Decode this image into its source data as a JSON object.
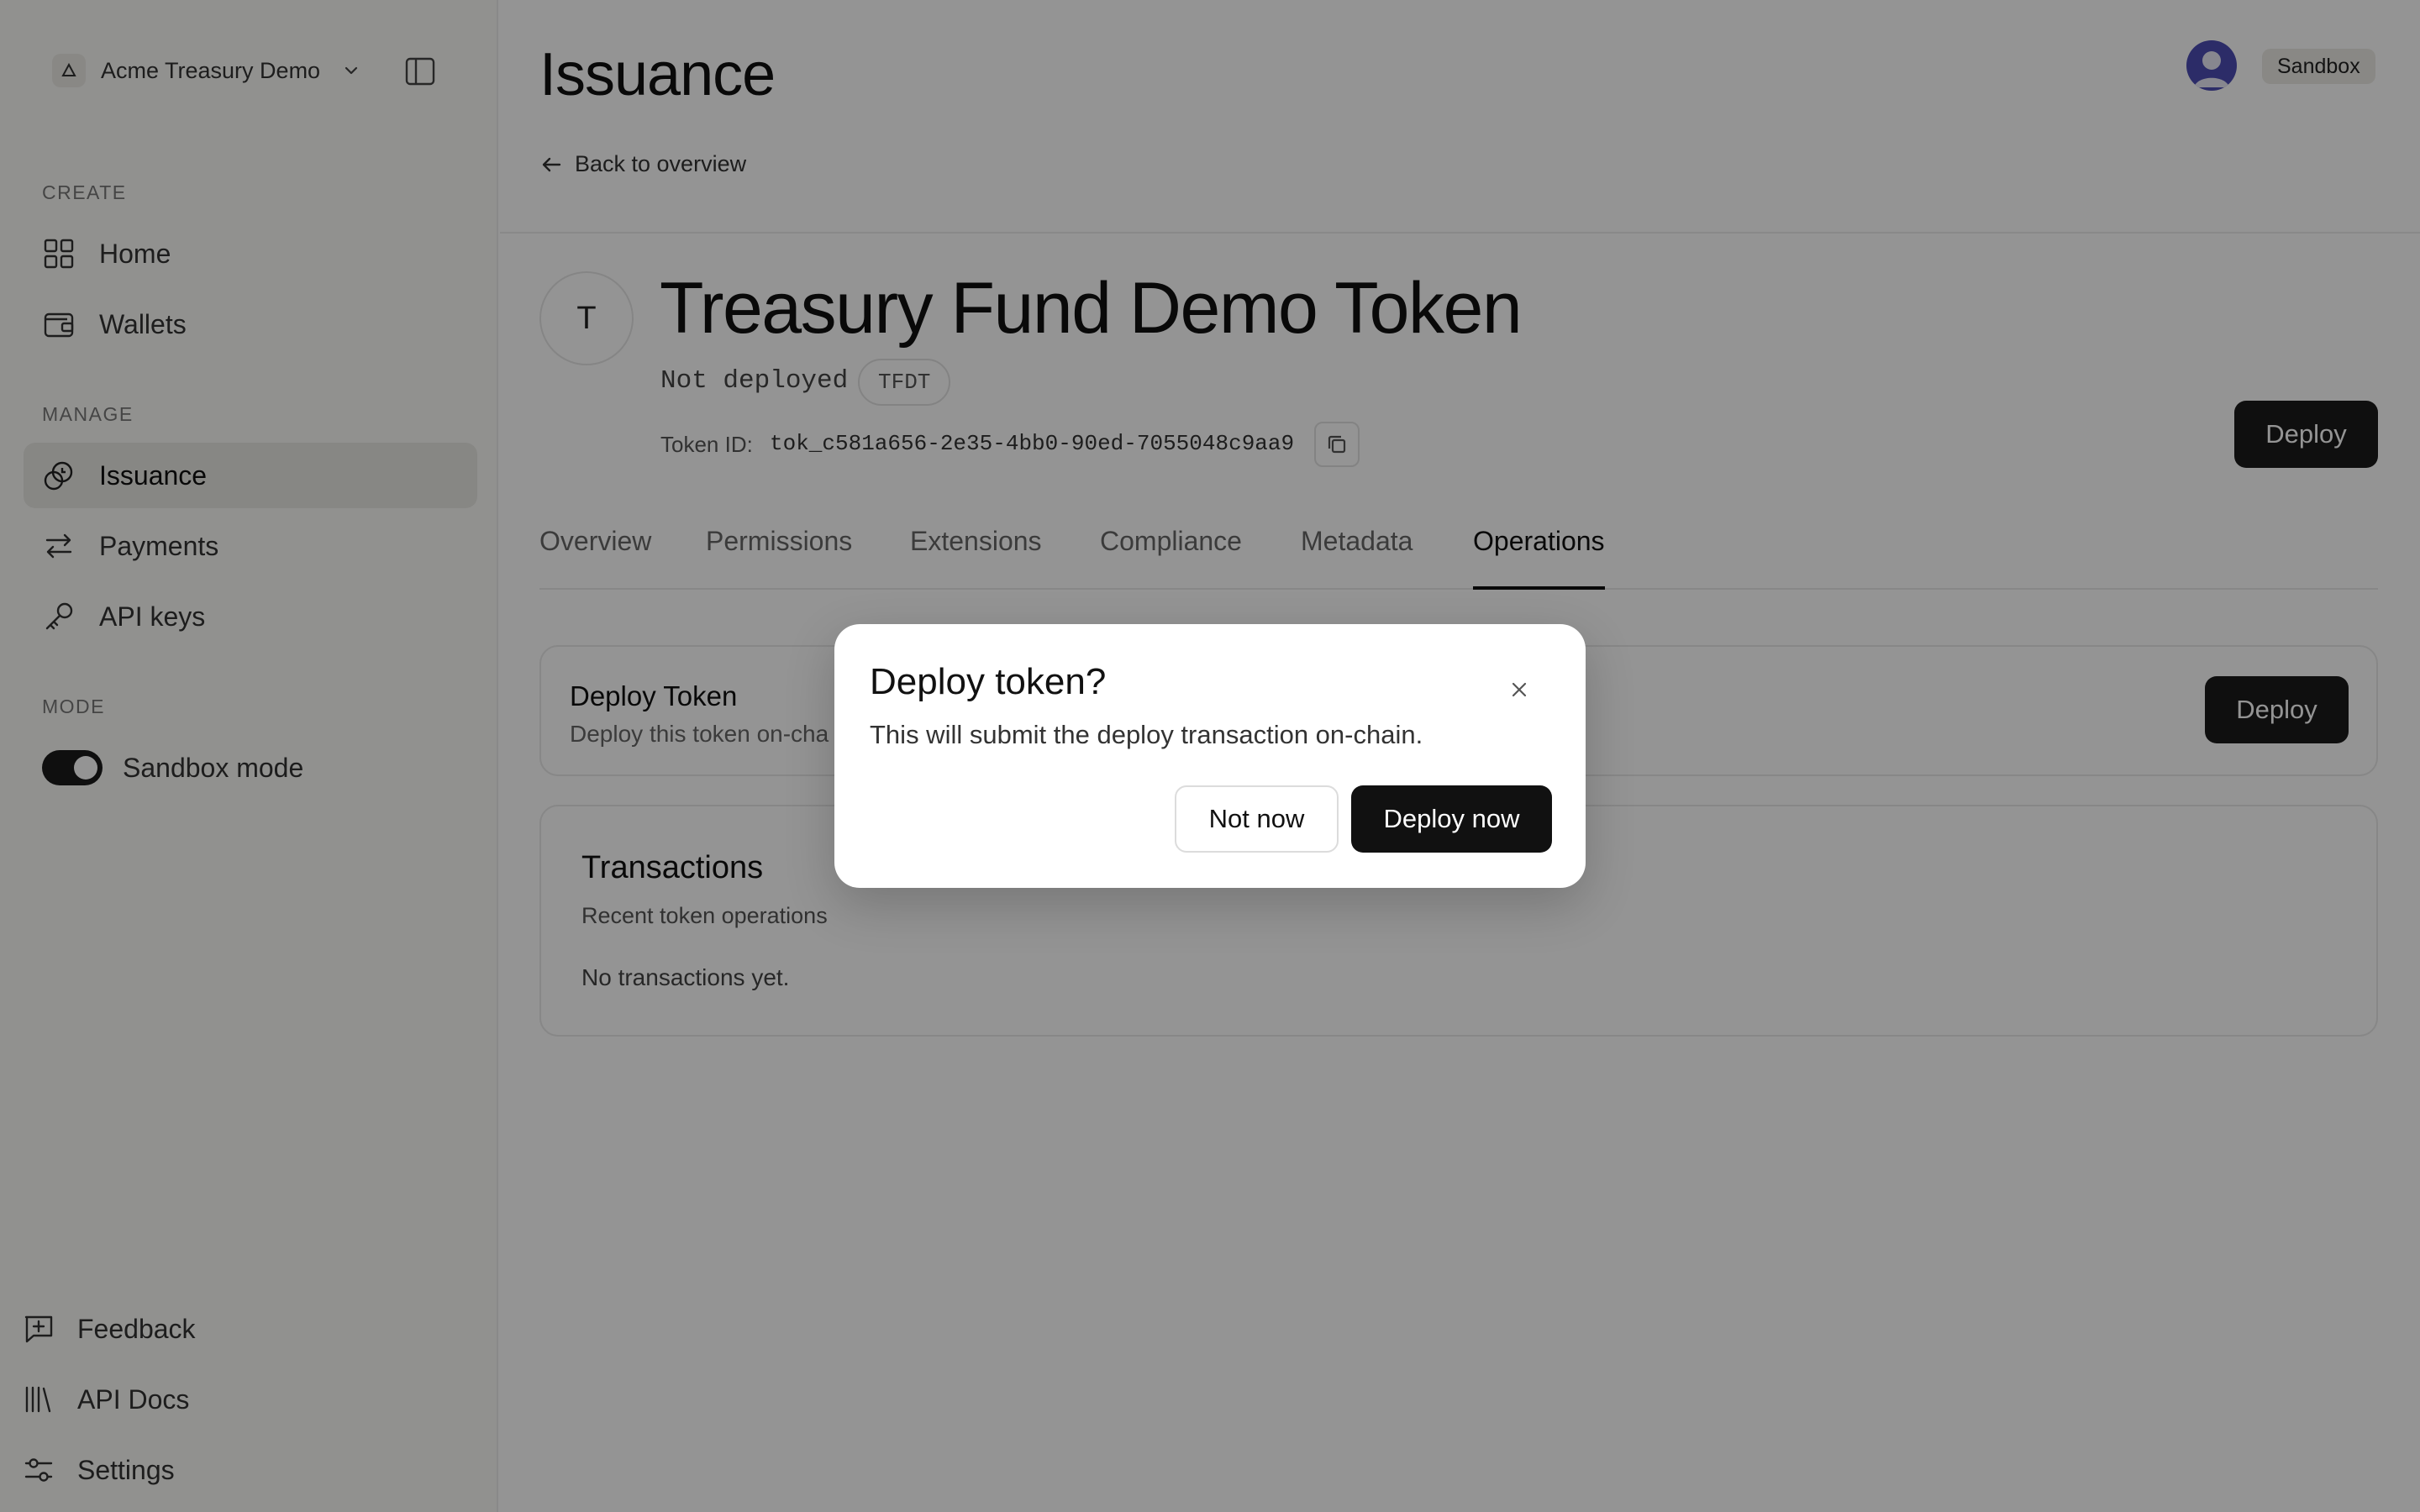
{
  "sidebar": {
    "workspace_name": "Acme Treasury Demo",
    "sections": {
      "create": "CREATE",
      "manage": "MANAGE",
      "mode": "MODE"
    },
    "items": [
      {
        "label": "Home",
        "icon": "grid-icon"
      },
      {
        "label": "Wallets",
        "icon": "wallet-icon"
      },
      {
        "label": "Issuance",
        "icon": "coins-icon",
        "active": true
      },
      {
        "label": "Payments",
        "icon": "arrows-swap-icon"
      },
      {
        "label": "API keys",
        "icon": "key-icon"
      }
    ],
    "sandbox_mode": {
      "label": "Sandbox mode",
      "on": true
    },
    "footer": [
      {
        "label": "Feedback",
        "icon": "feedback-icon"
      },
      {
        "label": "API Docs",
        "icon": "library-icon"
      },
      {
        "label": "Settings",
        "icon": "sliders-icon"
      }
    ]
  },
  "header": {
    "title": "Issuance",
    "back_label": "Back to overview",
    "env_badge": "Sandbox"
  },
  "token": {
    "avatar_letter": "T",
    "name": "Treasury Fund Demo Token",
    "status": "Not deployed",
    "symbol": "TFDT",
    "id_label": "Token ID:",
    "id_value": "tok_c581a656-2e35-4bb0-90ed-7055048c9aa9",
    "deploy_label": "Deploy"
  },
  "tabs": [
    {
      "label": "Overview"
    },
    {
      "label": "Permissions"
    },
    {
      "label": "Extensions"
    },
    {
      "label": "Compliance"
    },
    {
      "label": "Metadata"
    },
    {
      "label": "Operations",
      "active": true
    }
  ],
  "deploy_card": {
    "title": "Deploy Token",
    "subtitle": "Deploy this token on-cha",
    "button": "Deploy"
  },
  "transactions_card": {
    "title": "Transactions",
    "subtitle": "Recent token operations",
    "empty": "No transactions yet."
  },
  "modal": {
    "title": "Deploy token?",
    "body": "This will submit the deploy transaction on-chain.",
    "cancel": "Not now",
    "confirm": "Deploy now"
  },
  "colors": {
    "accent": "#1a1a1a",
    "avatar": "#4c4db3",
    "overlay": "rgba(0,0,0,0.42)"
  }
}
